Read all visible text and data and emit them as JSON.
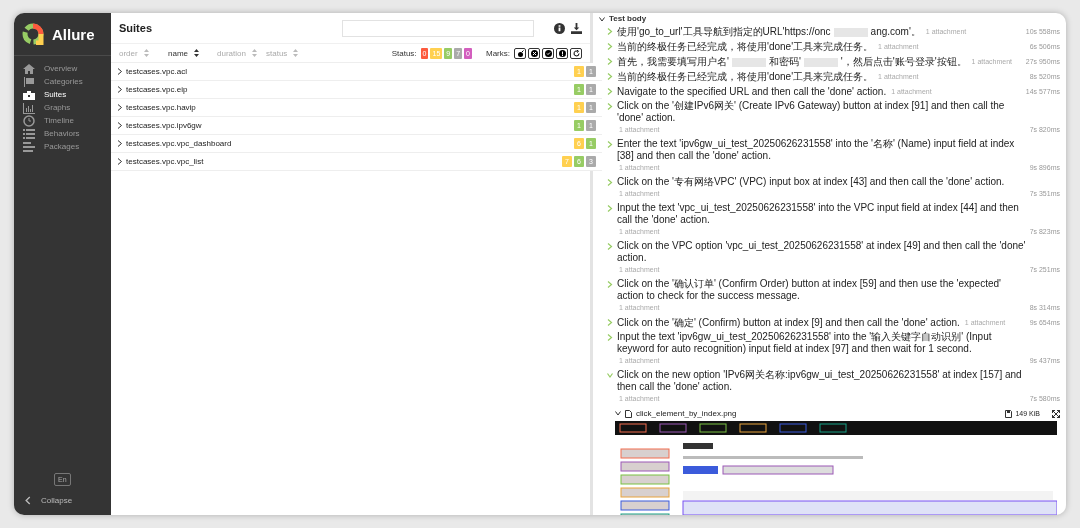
{
  "sidebar": {
    "brand": "Allure",
    "items": [
      {
        "label": "Overview",
        "selected": false
      },
      {
        "label": "Categories",
        "selected": false
      },
      {
        "label": "Suites",
        "selected": true
      },
      {
        "label": "Graphs",
        "selected": false
      },
      {
        "label": "Timeline",
        "selected": false
      },
      {
        "label": "Behaviors",
        "selected": false
      },
      {
        "label": "Packages",
        "selected": false
      }
    ],
    "language": "En",
    "collapse": "Collapse"
  },
  "suites": {
    "title": "Suites",
    "sorters": [
      {
        "label": "order",
        "selected": false
      },
      {
        "label": "name",
        "selected": true
      },
      {
        "label": "duration",
        "selected": false
      },
      {
        "label": "status",
        "selected": false
      }
    ],
    "status_label": "Status:",
    "status_filters": [
      {
        "count": "0",
        "color": "#fd5a3e"
      },
      {
        "count": "15",
        "color": "#ffd050"
      },
      {
        "count": "9",
        "color": "#97cc64"
      },
      {
        "count": "7",
        "color": "#aaaaaa"
      },
      {
        "count": "0",
        "color": "#d35ebe"
      }
    ],
    "marks_label": "Marks:",
    "rows": [
      {
        "name": "testcases.vpc.acl",
        "counts": [
          {
            "count": "1",
            "color": "#ffd050"
          },
          {
            "count": "1",
            "color": "#aaaaaa"
          }
        ]
      },
      {
        "name": "testcases.vpc.eip",
        "counts": [
          {
            "count": "1",
            "color": "#97cc64"
          },
          {
            "count": "1",
            "color": "#aaaaaa"
          }
        ]
      },
      {
        "name": "testcases.vpc.havip",
        "counts": [
          {
            "count": "1",
            "color": "#ffd050"
          },
          {
            "count": "1",
            "color": "#aaaaaa"
          }
        ]
      },
      {
        "name": "testcases.vpc.ipv6gw",
        "counts": [
          {
            "count": "1",
            "color": "#97cc64"
          },
          {
            "count": "1",
            "color": "#aaaaaa"
          }
        ]
      },
      {
        "name": "testcases.vpc.vpc_dashboard",
        "counts": [
          {
            "count": "6",
            "color": "#ffd050"
          },
          {
            "count": "1",
            "color": "#97cc64"
          }
        ]
      },
      {
        "name": "testcases.vpc.vpc_list",
        "counts": [
          {
            "count": "7",
            "color": "#ffd050"
          },
          {
            "count": "6",
            "color": "#97cc64"
          },
          {
            "count": "3",
            "color": "#aaaaaa"
          }
        ]
      }
    ]
  },
  "test_body": {
    "title": "Test body",
    "expanded": true,
    "steps": [
      {
        "text_parts": [
          "使用'go_to_url'工具导航到指定的URL'https://onc",
          "ang.com'。"
        ],
        "attachments": "1 attachment",
        "duration": "10s 558ms",
        "expanded": false
      },
      {
        "text_parts": [
          "当前的终极任务已经完成，将使用'done'工具来完成任务。"
        ],
        "attachments": "1 attachment",
        "duration": "6s 506ms",
        "expanded": false
      },
      {
        "text_parts": [
          "首先，我需要填写用户名'",
          "和密码'",
          "'，然后点击'账号登录'按钮。"
        ],
        "attachments": "1 attachment",
        "duration": "27s 950ms",
        "expanded": false
      },
      {
        "text_parts": [
          "当前的终极任务已经完成，将使用'done'工具来完成任务。"
        ],
        "attachments": "1 attachment",
        "duration": "8s 520ms",
        "expanded": false
      },
      {
        "text_parts": [
          "Navigate to the specified URL and then call the 'done' action."
        ],
        "attachments": "1 attachment",
        "duration": "14s 577ms",
        "expanded": false
      },
      {
        "text_parts": [
          "Click on the '创建IPv6网关' (Create IPv6 Gateway) button at index [91] and then call the 'done' action."
        ],
        "attachments": "1 attachment",
        "duration": "7s 820ms",
        "expanded": false
      },
      {
        "text_parts": [
          "Enter the text 'ipv6gw_ui_test_20250626231558' into the '名称' (Name) input field at index [38] and then call the 'done' action."
        ],
        "attachments": "1 attachment",
        "duration": "9s 896ms",
        "expanded": false
      },
      {
        "text_parts": [
          "Click on the '专有网络VPC' (VPC) input box at index [43] and then call the 'done' action."
        ],
        "attachments": "1 attachment",
        "duration": "7s 351ms",
        "expanded": false
      },
      {
        "text_parts": [
          "Input the text 'vpc_ui_test_20250626231558' into the VPC input field at index [44] and then call the 'done' action."
        ],
        "attachments": "1 attachment",
        "duration": "7s 823ms",
        "expanded": false
      },
      {
        "text_parts": [
          "Click on the VPC option 'vpc_ui_test_20250626231558' at index [49] and then call the 'done' action."
        ],
        "attachments": "1 attachment",
        "duration": "7s 251ms",
        "expanded": false
      },
      {
        "text_parts": [
          "Click on the '确认订单' (Confirm Order) button at index [59] and then use the 'expected' action to check for the success message."
        ],
        "attachments": "1 attachment",
        "duration": "8s 314ms",
        "expanded": false
      },
      {
        "text_parts": [
          "Click on the '确定' (Confirm) button at index [9] and then call the 'done' action."
        ],
        "attachments": "1 attachment",
        "duration": "9s 654ms",
        "expanded": false
      },
      {
        "text_parts": [
          "Input the text 'ipv6gw_ui_test_20250626231558' into the '输入关键字自动识别' (Input keyword for auto recognition) input field at index [97] and then wait for 1 second."
        ],
        "attachments": "1 attachment",
        "duration": "9s 437ms",
        "expanded": false
      },
      {
        "text_parts": [
          "Click on the new option 'IPv6网关名称:ipv6gw_ui_test_20250626231558' at index [157] and then call the 'done' action."
        ],
        "attachments": "1 attachment",
        "duration": "7s 580ms",
        "expanded": true,
        "attachment": {
          "name": "click_element_by_index.png",
          "size": "149 KiB",
          "expanded": true
        }
      }
    ]
  }
}
